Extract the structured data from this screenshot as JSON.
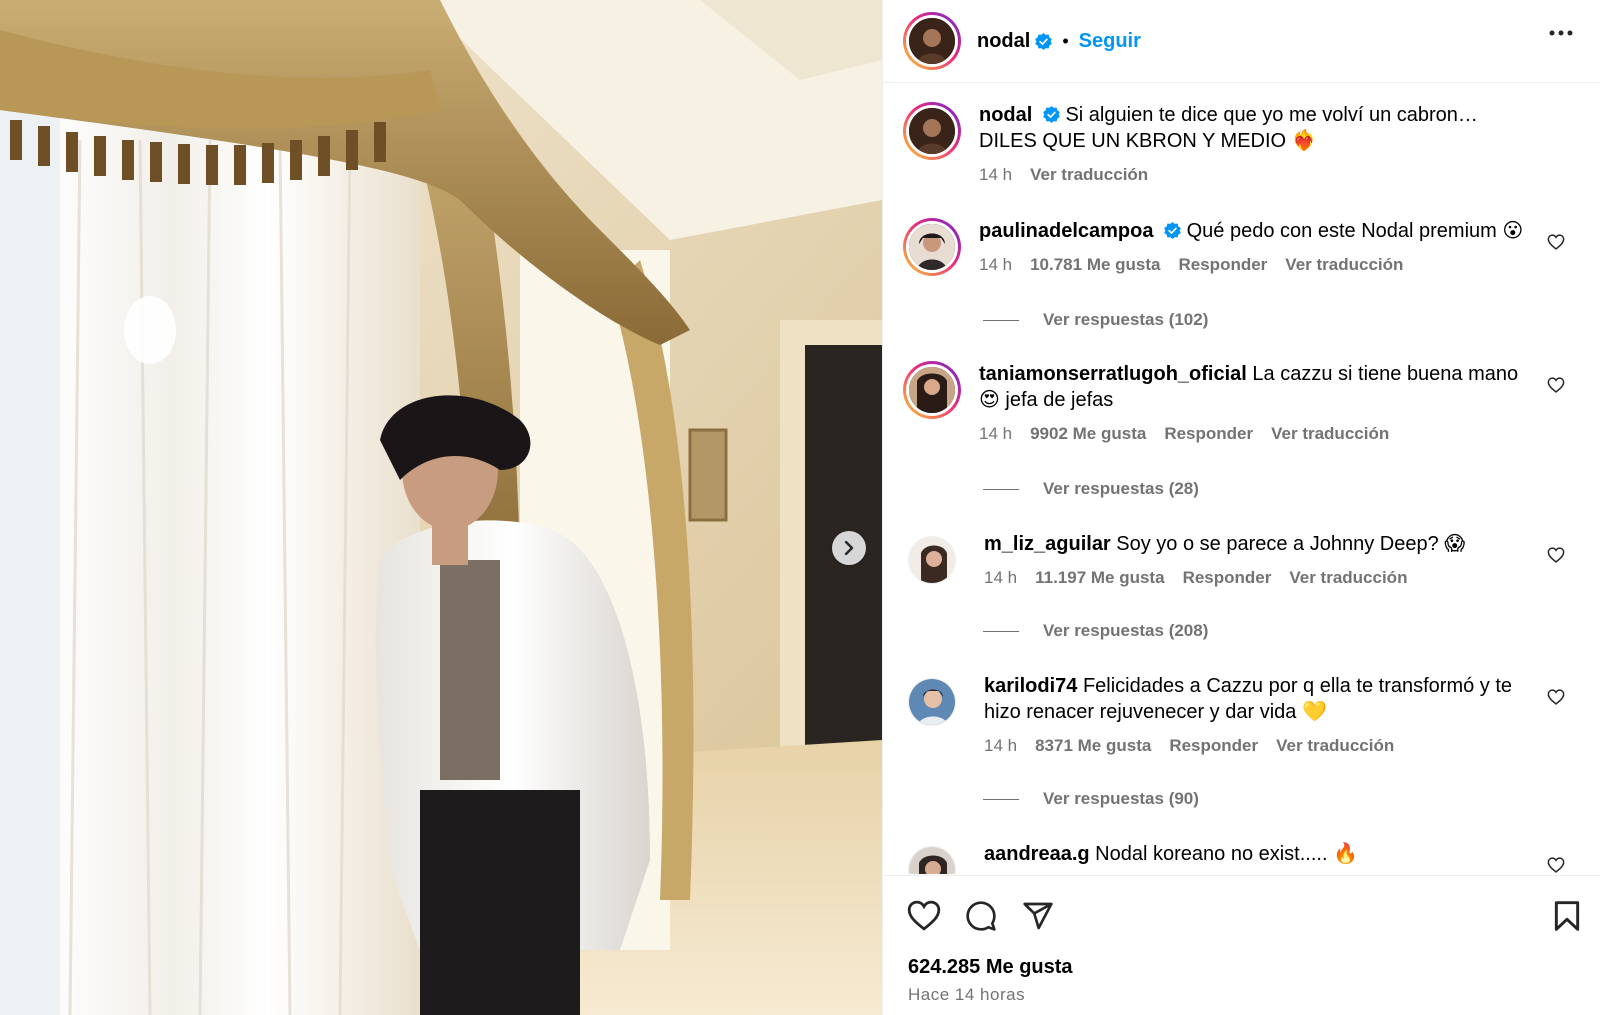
{
  "post": {
    "username": "nodal",
    "follow_label": "Seguir",
    "separator": "•",
    "caption_line1": "Si alguien te dice que yo me volví un cabron…",
    "caption_line2": "DILES QUE UN KBRON Y MEDIO ❤️‍🔥",
    "caption_time": "14 h",
    "caption_translate": "Ver traducción"
  },
  "comments": [
    {
      "user": "paulinadelcampoa",
      "verified": true,
      "text": "Qué pedo con este Nodal premium 😮",
      "time": "14 h",
      "likes": "10.781 Me gusta",
      "reply": "Responder",
      "translate": "Ver traducción",
      "replies": "Ver respuestas (102)"
    },
    {
      "user": "taniamonserratlugoh_oficial",
      "verified": false,
      "text": "La cazzu si tiene buena mano",
      "text2": "😍 jefa de jefas",
      "time": "14 h",
      "likes": "9902 Me gusta",
      "reply": "Responder",
      "translate": "Ver traducción",
      "replies": "Ver respuestas (28)"
    },
    {
      "user": "m_liz_aguilar",
      "verified": false,
      "text": "Soy yo o se parece a Johnny Deep? 😱",
      "time": "14 h",
      "likes": "11.197 Me gusta",
      "reply": "Responder",
      "translate": "Ver traducción",
      "replies": "Ver respuestas (208)"
    },
    {
      "user": "karilodi74",
      "verified": false,
      "text": "Felicidades a Cazzu por q ella te transformó y te",
      "text2": "hizo renacer rejuvenecer y dar vida 💛",
      "time": "14 h",
      "likes": "8371 Me gusta",
      "reply": "Responder",
      "translate": "Ver traducción",
      "replies": "Ver respuestas (90)"
    },
    {
      "user": "aandreaa.g",
      "verified": false,
      "text": "Nodal koreano no exist..... 🔥"
    }
  ],
  "footer": {
    "likes": "624.285 Me gusta",
    "ago": "Hace 14 horas"
  },
  "icons": {
    "verified": "verified-badge-icon",
    "more": "more-options-icon",
    "like": "heart-icon",
    "comment": "comment-icon",
    "share": "share-icon",
    "save": "bookmark-icon",
    "next": "chevron-right-icon"
  },
  "colors": {
    "accent": "#0095f6",
    "muted": "#737373",
    "border": "#efefef"
  }
}
